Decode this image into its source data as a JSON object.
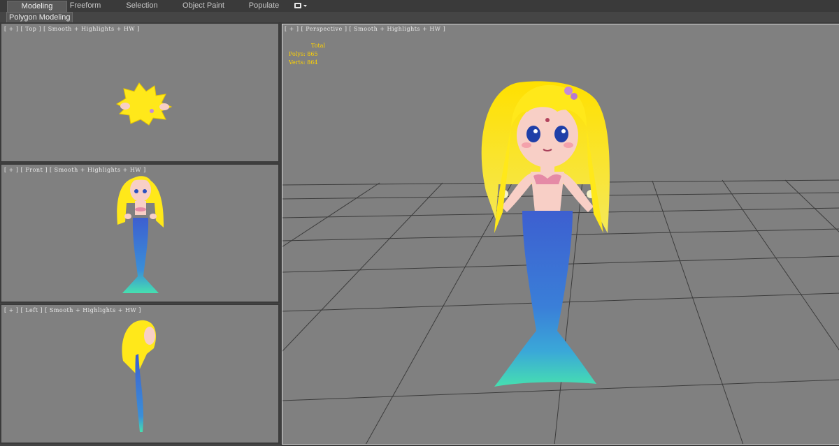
{
  "ribbon": {
    "tabs": [
      {
        "label": "Modeling",
        "active": true
      },
      {
        "label": "Freeform",
        "active": false
      },
      {
        "label": "Selection",
        "active": false
      },
      {
        "label": "Object Paint",
        "active": false
      },
      {
        "label": "Populate",
        "active": false
      }
    ],
    "dropdown_icon": "ribbon-options-icon",
    "active_panel": "Polygon Modeling"
  },
  "viewports": {
    "top": {
      "label": "[ + ] [ Top ] [ Smooth + Highlights + HW ]"
    },
    "front": {
      "label": "[ + ] [ Front ] [ Smooth + Highlights + HW ]"
    },
    "left": {
      "label": "[ + ] [ Left ] [ Smooth + Highlights + HW ]"
    },
    "perspective": {
      "label": "[ + ] [ Perspective ] [ Smooth + Highlights + HW ]",
      "stats": {
        "total": "Total",
        "polys": "Polys: 865",
        "verts": "Verts: 864"
      }
    }
  },
  "colors": {
    "viewport_bg": "#808080",
    "grid_line": "#3c3c3c",
    "stats_text": "#ffd200",
    "hair": "#ffe81a",
    "tail_top": "#3d5fd0",
    "tail_fin": "#46e0b0",
    "skin": "#f8cfc6"
  }
}
